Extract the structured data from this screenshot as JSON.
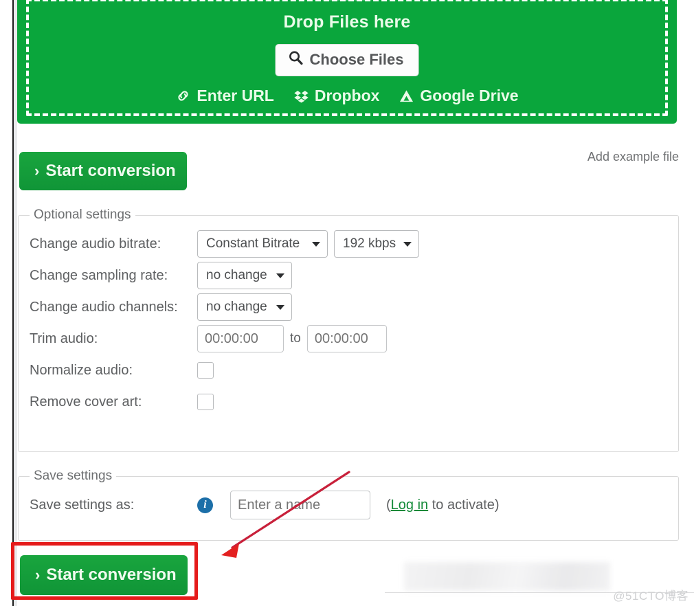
{
  "dropzone": {
    "title": "Drop Files here",
    "choose_files_label": "Choose Files",
    "search_icon": "search-icon",
    "sources": [
      {
        "label": "Enter URL",
        "icon": "link-icon"
      },
      {
        "label": "Dropbox",
        "icon": "dropbox-icon"
      },
      {
        "label": "Google Drive",
        "icon": "google-drive-icon"
      }
    ],
    "background_color": "#0aa63c"
  },
  "actions": {
    "start_conversion_top": "Start conversion",
    "start_conversion_bottom": "Start conversion",
    "chevron": "›",
    "add_example_file": "Add example file",
    "button_color": "#19a53e"
  },
  "optional_settings": {
    "legend": "Optional settings",
    "rows": [
      {
        "label": "Change audio bitrate:",
        "controls": [
          {
            "type": "select",
            "value": "Constant Bitrate"
          },
          {
            "type": "select",
            "value": "192 kbps"
          }
        ]
      },
      {
        "label": "Change sampling rate:",
        "controls": [
          {
            "type": "select",
            "value": "no change"
          }
        ]
      },
      {
        "label": "Change audio channels:",
        "controls": [
          {
            "type": "select",
            "value": "no change"
          }
        ]
      },
      {
        "label": "Trim audio:",
        "separator": "to",
        "controls": [
          {
            "type": "text",
            "placeholder": "00:00:00",
            "value": ""
          },
          {
            "type": "text",
            "placeholder": "00:00:00",
            "value": ""
          }
        ]
      },
      {
        "label": "Normalize audio:",
        "controls": [
          {
            "type": "checkbox",
            "checked": false
          }
        ]
      },
      {
        "label": "Remove cover art:",
        "controls": [
          {
            "type": "checkbox",
            "checked": false
          }
        ]
      }
    ]
  },
  "save_settings": {
    "legend": "Save settings",
    "label": "Save settings as:",
    "info_icon": "info-icon",
    "info_glyph": "i",
    "name_placeholder": "Enter a name",
    "name_value": "",
    "note_prefix": "(",
    "note_link": "Log in",
    "note_suffix": " to activate)",
    "link_color": "#148a39"
  },
  "annotations": {
    "highlight_color": "#e51b1b",
    "arrow_color": "#c8203a"
  },
  "watermark": {
    "text": "@51CTO博客"
  }
}
